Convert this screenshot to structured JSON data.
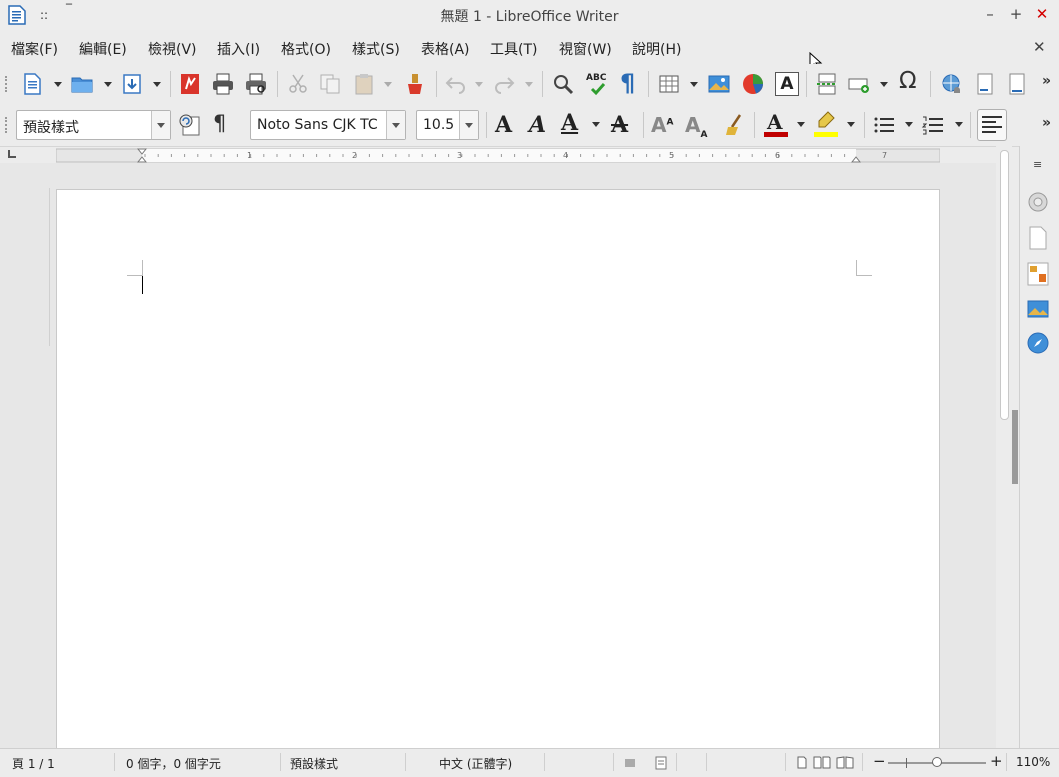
{
  "window": {
    "title": "無題 1 - LibreOffice Writer"
  },
  "menu": [
    "檔案(F)",
    "編輯(E)",
    "檢視(V)",
    "插入(I)",
    "格式(O)",
    "樣式(S)",
    "表格(A)",
    "工具(T)",
    "視窗(W)",
    "說明(H)"
  ],
  "format_toolbar": {
    "paragraph_style": "預設樣式",
    "font_name": "Noto Sans CJK TC",
    "font_size": "10.5"
  },
  "standard_toolbar": {
    "spelling_icon_text": "ABC"
  },
  "ruler": {
    "numbers": [
      "1",
      "2",
      "3",
      "4",
      "5",
      "6",
      "7"
    ]
  },
  "status_bar": {
    "page": "頁 1 / 1",
    "word_count": "0 個字，0 個字元",
    "page_style": "預設樣式",
    "language": "中文 (正體字)",
    "zoom": "110%"
  },
  "colors": {
    "font_color": "#c00000",
    "highlight_color": "#ffff00",
    "close_accent": "#d40000"
  },
  "icons": [
    "writer-document-icon",
    "new-document-icon",
    "open-folder-icon",
    "save-icon",
    "export-pdf-icon",
    "print-icon",
    "print-preview-icon",
    "cut-icon",
    "copy-icon",
    "paste-icon",
    "clone-formatting-icon",
    "undo-icon",
    "redo-icon",
    "find-replace-icon",
    "spelling-icon",
    "formatting-marks-icon",
    "table-icon",
    "image-icon",
    "chart-icon",
    "text-box-icon",
    "page-break-icon",
    "field-icon",
    "special-character-icon",
    "hyperlink-icon",
    "footnote-icon",
    "endnote-icon",
    "omega-icon"
  ]
}
